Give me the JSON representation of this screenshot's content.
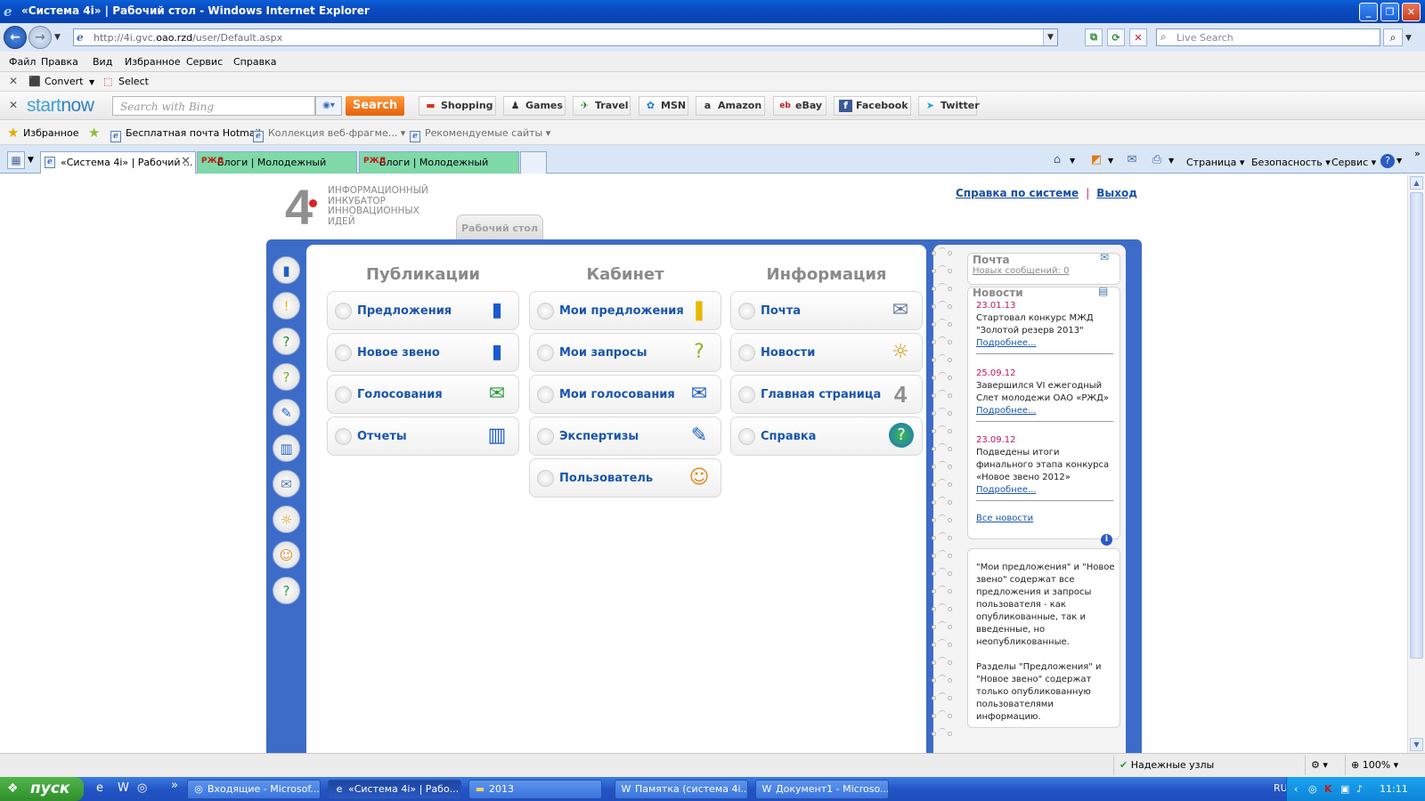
{
  "window": {
    "title": "«Система 4i» | Рабочий стол - Windows Internet Explorer",
    "min": "_",
    "max": "❐",
    "close": "✕"
  },
  "address": {
    "url_pre": "http://4i.gvc.",
    "url_host": "oao.rzd",
    "url_post": "/user/Default.aspx",
    "live_search_placeholder": "Live Search"
  },
  "menu": [
    "Файл",
    "Правка",
    "Вид",
    "Избранное",
    "Сервис",
    "Справка"
  ],
  "convert_bar": {
    "convert": "Convert",
    "select": "Select"
  },
  "startnow": {
    "logo_a": "start",
    "logo_b": "now",
    "search_placeholder": "Search with Bing",
    "search_button": "Search",
    "links": [
      "Shopping",
      "Games",
      "Travel",
      "MSN",
      "Amazon",
      "eBay",
      "Facebook",
      "Twitter"
    ]
  },
  "favorites": {
    "label": "Избранное",
    "items": [
      "Бесплатная почта Hotmail",
      "Коллекция веб-фрагме...",
      "Рекомендуемые сайты"
    ]
  },
  "tabs": [
    "«Система 4i» | Рабочий ...",
    "Блоги | Молодежный",
    "Блоги | Молодежный"
  ],
  "tab_rzd": "РЖД",
  "commands": [
    "Страница",
    "Безопасность",
    "Сервис"
  ],
  "page": {
    "logo_digit": "4",
    "logo_lines": [
      "Информационный",
      "инкубатор",
      "инновационных",
      "идей"
    ],
    "help_link": "Справка по системе",
    "separator": "|",
    "logout_link": "Выход",
    "desktop_tab": "Рабочий стол",
    "columns": [
      {
        "title": "Публикации",
        "items": [
          "Предложения",
          "Новое звено",
          "Голосования",
          "Отчеты"
        ]
      },
      {
        "title": "Кабинет",
        "items": [
          "Мои предложения",
          "Мои запросы",
          "Мои голосования",
          "Экспертизы",
          "Пользователь"
        ]
      },
      {
        "title": "Информация",
        "items": [
          "Почта",
          "Новости",
          "Главная страница",
          "Справка"
        ]
      }
    ],
    "mail": {
      "title": "Почта",
      "new_messages": "Новых сообщений: 0"
    },
    "news": {
      "title": "Новости",
      "items": [
        {
          "date": "23.01.13",
          "text": "Стартовал конкурс МЖД \"Золотой резерв 2013\"",
          "more": "Подробнее..."
        },
        {
          "date": "25.09.12",
          "text": "Завершился VI ежегодный Слет молодежи ОАО «РЖД»",
          "more": "Подробнее..."
        },
        {
          "date": "23.09.12",
          "text": "Подведены итоги финального этапа конкурса «Новое звено 2012»",
          "more": "Подробнее..."
        }
      ],
      "all": "Все новости"
    },
    "note_p1": "\"Мои предложения\" и \"Новое звено\" содержат все предложения и запросы пользователя - как опубликованные, так и введенные, но неопубликованные.",
    "note_p2": "Разделы \"Предложения\" и \"Новое звено\" содержат только опубликованную пользователями информацию."
  },
  "status": {
    "zone": "Надежные узлы",
    "zoom": "100%"
  },
  "taskbar": {
    "start": "пуск",
    "buttons": [
      "Входящие - Microsof...",
      "«Система 4i» | Рабо...",
      "2013",
      "Памятка (система 4i...",
      "Документ1 - Microso..."
    ],
    "lang": "RU",
    "clock": "11:11"
  }
}
